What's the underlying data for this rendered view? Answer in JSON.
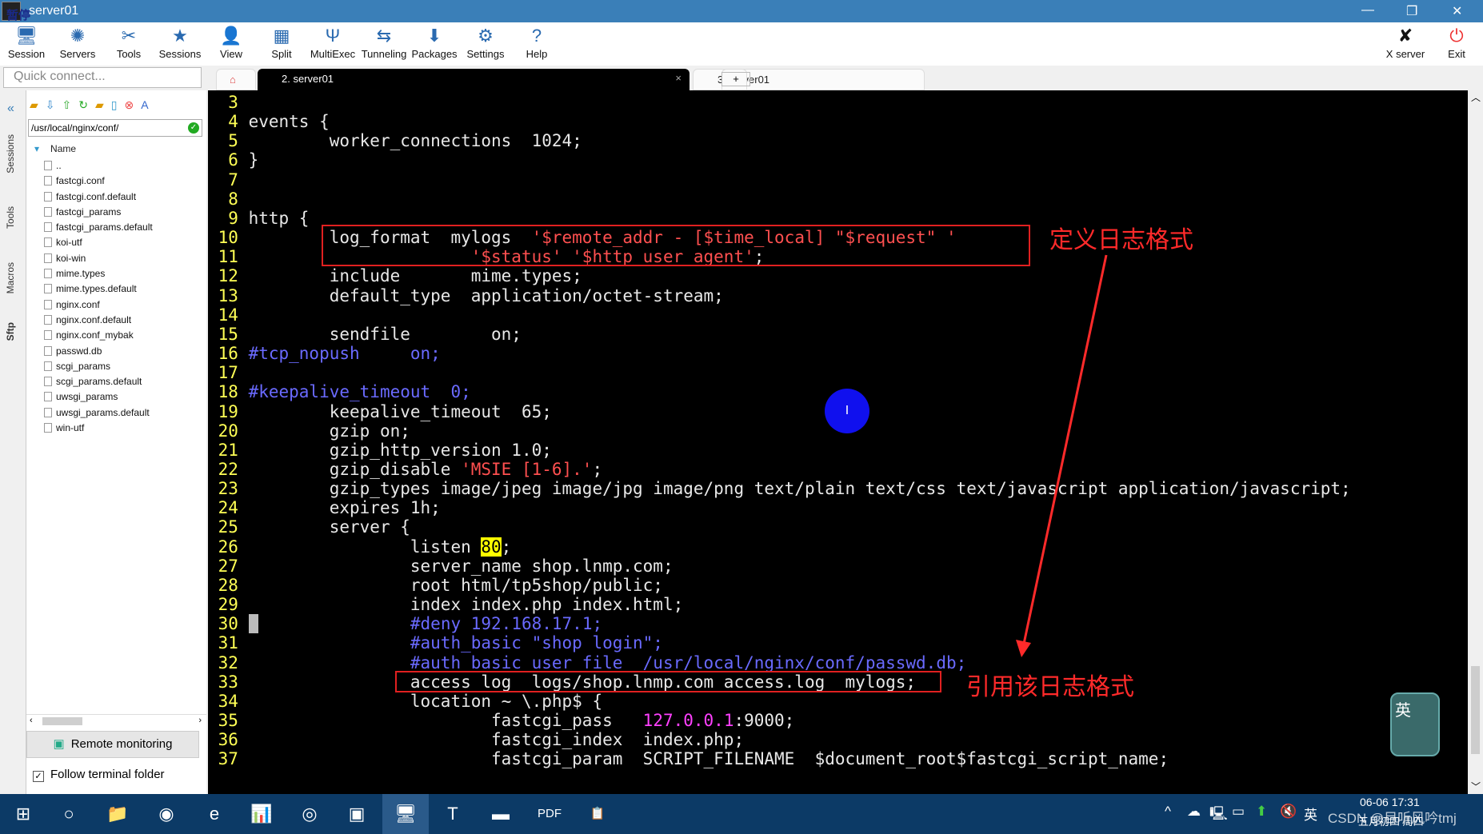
{
  "window": {
    "title": "server01",
    "overlay_badge": "暂停",
    "minimize": "—",
    "restore": "❐",
    "close": "✕"
  },
  "toolbar": {
    "items": [
      {
        "label": "Session",
        "icon": "🖥"
      },
      {
        "label": "Servers",
        "icon": "✺"
      },
      {
        "label": "Tools",
        "icon": "✂"
      },
      {
        "label": "Sessions",
        "icon": "★"
      },
      {
        "label": "View",
        "icon": "👤"
      },
      {
        "label": "Split",
        "icon": "▦"
      },
      {
        "label": "MultiExec",
        "icon": "Ψ"
      },
      {
        "label": "Tunneling",
        "icon": "⇆"
      },
      {
        "label": "Packages",
        "icon": "⬇"
      },
      {
        "label": "Settings",
        "icon": "⚙"
      },
      {
        "label": "Help",
        "icon": "?"
      }
    ],
    "xserver": "X server",
    "exit": "Exit"
  },
  "quick_connect": {
    "placeholder": "Quick connect..."
  },
  "tabs": [
    {
      "label": "2. server01",
      "close": "×"
    },
    {
      "label": "3. server01"
    }
  ],
  "vertical_tabs": [
    "Sessions",
    "Tools",
    "Macros",
    "Sftp"
  ],
  "sftp": {
    "path": "/usr/local/nginx/conf/",
    "name_header": "Name",
    "files": [
      "..",
      "fastcgi.conf",
      "fastcgi.conf.default",
      "fastcgi_params",
      "fastcgi_params.default",
      "koi-utf",
      "koi-win",
      "mime.types",
      "mime.types.default",
      "nginx.conf",
      "nginx.conf.default",
      "nginx.conf_mybak",
      "passwd.db",
      "scgi_params",
      "scgi_params.default",
      "uwsgi_params",
      "uwsgi_params.default",
      "win-utf"
    ],
    "remote_monitoring": "Remote monitoring",
    "follow_terminal": "Follow terminal folder",
    "follow_checked": true
  },
  "terminal": {
    "lines": [
      {
        "n": "3",
        "segs": []
      },
      {
        "n": "4",
        "segs": [
          [
            "events {",
            "n"
          ]
        ]
      },
      {
        "n": "5",
        "segs": [
          [
            "        worker_connections  1024;",
            "n"
          ]
        ]
      },
      {
        "n": "6",
        "segs": [
          [
            "}",
            "n"
          ]
        ]
      },
      {
        "n": "7",
        "segs": []
      },
      {
        "n": "8",
        "segs": []
      },
      {
        "n": "9",
        "segs": [
          [
            "http {",
            "n"
          ]
        ]
      },
      {
        "n": "10",
        "segs": [
          [
            "        log_format  mylogs  ",
            "n"
          ],
          [
            "'$remote_addr - [$time_local] \"$request\" '",
            "s"
          ]
        ]
      },
      {
        "n": "11",
        "segs": [
          [
            "                      ",
            "n"
          ],
          [
            "'$status' '$http_user_agent'",
            "s"
          ],
          [
            ";",
            "n"
          ]
        ]
      },
      {
        "n": "12",
        "segs": [
          [
            "        include       mime.types;",
            "n"
          ]
        ]
      },
      {
        "n": "13",
        "segs": [
          [
            "        default_type  application/octet-stream;",
            "n"
          ]
        ]
      },
      {
        "n": "14",
        "segs": []
      },
      {
        "n": "15",
        "segs": [
          [
            "        sendfile        on;",
            "n"
          ]
        ]
      },
      {
        "n": "16",
        "segs": [
          [
            "#tcp_nopush     on;",
            "c"
          ]
        ]
      },
      {
        "n": "17",
        "segs": []
      },
      {
        "n": "18",
        "segs": [
          [
            "#keepalive_timeout  0;",
            "c"
          ]
        ]
      },
      {
        "n": "19",
        "segs": [
          [
            "        keepalive_timeout  65;",
            "n"
          ]
        ]
      },
      {
        "n": "20",
        "segs": [
          [
            "        gzip on;",
            "n"
          ]
        ]
      },
      {
        "n": "21",
        "segs": [
          [
            "        gzip_http_version 1.0;",
            "n"
          ]
        ]
      },
      {
        "n": "22",
        "segs": [
          [
            "        gzip_disable ",
            "n"
          ],
          [
            "'MSIE [1-6].'",
            "s"
          ],
          [
            ";",
            "n"
          ]
        ]
      },
      {
        "n": "23",
        "segs": [
          [
            "        gzip_types image/jpeg image/jpg image/png text/plain text/css text/javascript application/javascript;",
            "n"
          ]
        ]
      },
      {
        "n": "24",
        "segs": [
          [
            "        expires 1h;",
            "n"
          ]
        ]
      },
      {
        "n": "25",
        "segs": [
          [
            "        server {",
            "n"
          ]
        ]
      },
      {
        "n": "26",
        "segs": [
          [
            "                listen ",
            "n"
          ],
          [
            "80",
            "h"
          ],
          [
            ";",
            "n"
          ]
        ]
      },
      {
        "n": "27",
        "segs": [
          [
            "                server_name shop.lnmp.com;",
            "n"
          ]
        ]
      },
      {
        "n": "28",
        "segs": [
          [
            "                root html/tp5shop/public;",
            "n"
          ]
        ]
      },
      {
        "n": "29",
        "segs": [
          [
            "                index index.php index.html;",
            "n"
          ]
        ]
      },
      {
        "n": "30",
        "segs": [
          [
            " ",
            "cur"
          ],
          [
            "               ",
            "n"
          ],
          [
            "#deny 192.168.17.1;",
            "c"
          ]
        ]
      },
      {
        "n": "31",
        "segs": [
          [
            "                ",
            "n"
          ],
          [
            "#auth_basic \"shop login\";",
            "c"
          ]
        ]
      },
      {
        "n": "32",
        "segs": [
          [
            "                ",
            "n"
          ],
          [
            "#auth_basic_user_file  /usr/local/nginx/conf/passwd.db;",
            "c"
          ]
        ]
      },
      {
        "n": "33",
        "segs": [
          [
            "                access_log  logs/shop.lnmp.com_access.log  mylogs;",
            "n"
          ]
        ]
      },
      {
        "n": "34",
        "segs": [
          [
            "                location ~ \\.php$ {",
            "n"
          ]
        ]
      },
      {
        "n": "35",
        "segs": [
          [
            "                        fastcgi_pass   ",
            "n"
          ],
          [
            "127.0.0.1",
            "m"
          ],
          [
            ":9000;",
            "n"
          ]
        ]
      },
      {
        "n": "36",
        "segs": [
          [
            "                        fastcgi_index  index.php;",
            "n"
          ]
        ]
      },
      {
        "n": "37",
        "segs": [
          [
            "                        fastcgi_param  SCRIPT_FILENAME  $document_root$fastcgi_script_name;",
            "n"
          ]
        ]
      }
    ]
  },
  "annotations": {
    "define": "定义日志格式",
    "reference": "引用该日志格式",
    "color": "#e02020"
  },
  "cursor_marker": "I",
  "ime": "英",
  "taskbar": {
    "apps": [
      "⊞",
      "○",
      "📁",
      "◉",
      "e",
      "📊",
      "◎",
      "▣",
      "🖥",
      "T",
      "▬",
      "PDF",
      "📋"
    ],
    "tray": {
      "caret": "^",
      "lang": "英",
      "date": "06-06 17:31",
      "lunar": "五月初四 周四",
      "watermark": "CSDN @目听风吟tmj"
    }
  }
}
